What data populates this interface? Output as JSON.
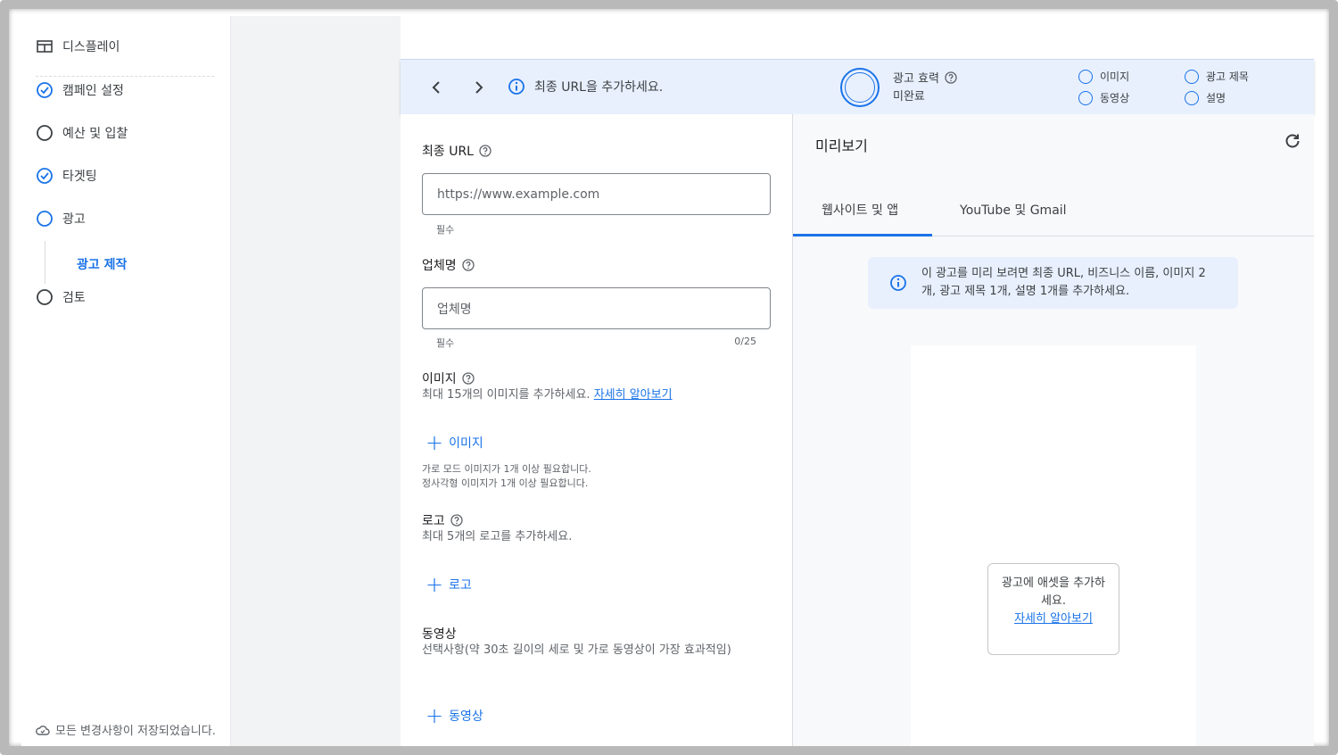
{
  "sidebar": {
    "items": [
      {
        "label": "디스플레이",
        "icon": "display-icon"
      },
      {
        "label": "캠페인 설정",
        "icon": "check-circle-icon"
      },
      {
        "label": "예산 및 입찰",
        "icon": "empty-circle-icon"
      },
      {
        "label": "타겟팅",
        "icon": "check-circle-icon"
      },
      {
        "label": "광고",
        "icon": "active-circle-icon"
      },
      {
        "label": "검토",
        "icon": "empty-circle-icon"
      }
    ],
    "sub_item": "광고 제작",
    "save_status": "모든 변경사항이 저장되었습니다."
  },
  "topbar": {
    "message": "최종 URL을 추가하세요.",
    "ad_strength_label": "광고 효력",
    "ad_strength_status": "미완료",
    "checklist": [
      "이미지",
      "동영상",
      "광고 제목",
      "설명"
    ]
  },
  "form": {
    "final_url": {
      "label": "최종 URL",
      "placeholder": "https://www.example.com",
      "hint": "필수"
    },
    "business_name": {
      "label": "업체명",
      "placeholder": "업체명",
      "hint": "필수",
      "count": "0/25"
    },
    "images": {
      "label": "이미지",
      "desc": "최대 15개의 이미지를 추가하세요.",
      "link": "자세히 알아보기",
      "add": "이미지",
      "note1": "가로 모드 이미지가 1개 이상 필요합니다.",
      "note2": "정사각형 이미지가 1개 이상 필요합니다."
    },
    "logo": {
      "label": "로고",
      "desc": "최대 5개의 로고를 추가하세요.",
      "add": "로고"
    },
    "video": {
      "label": "동영상",
      "desc": "선택사항(약 30초 길이의 세로 및 가로 동영상이 가장 효과적임)",
      "add": "동영상"
    }
  },
  "preview": {
    "title": "미리보기",
    "tabs": [
      "웹사이트 및 앱",
      "YouTube 및 Gmail"
    ],
    "info": "이 광고를 미리 보려면 최종 URL, 비즈니스 이름, 이미지 2개, 광고 제목 1개, 설명 1개를 추가하세요.",
    "card_text": "광고에 애셋을 추가하세요.",
    "card_link": "자세히 알아보기"
  },
  "colors": {
    "accent": "#1a73e8",
    "topbar_bg": "#e8f0fe",
    "gutter": "#f1f3f4"
  }
}
